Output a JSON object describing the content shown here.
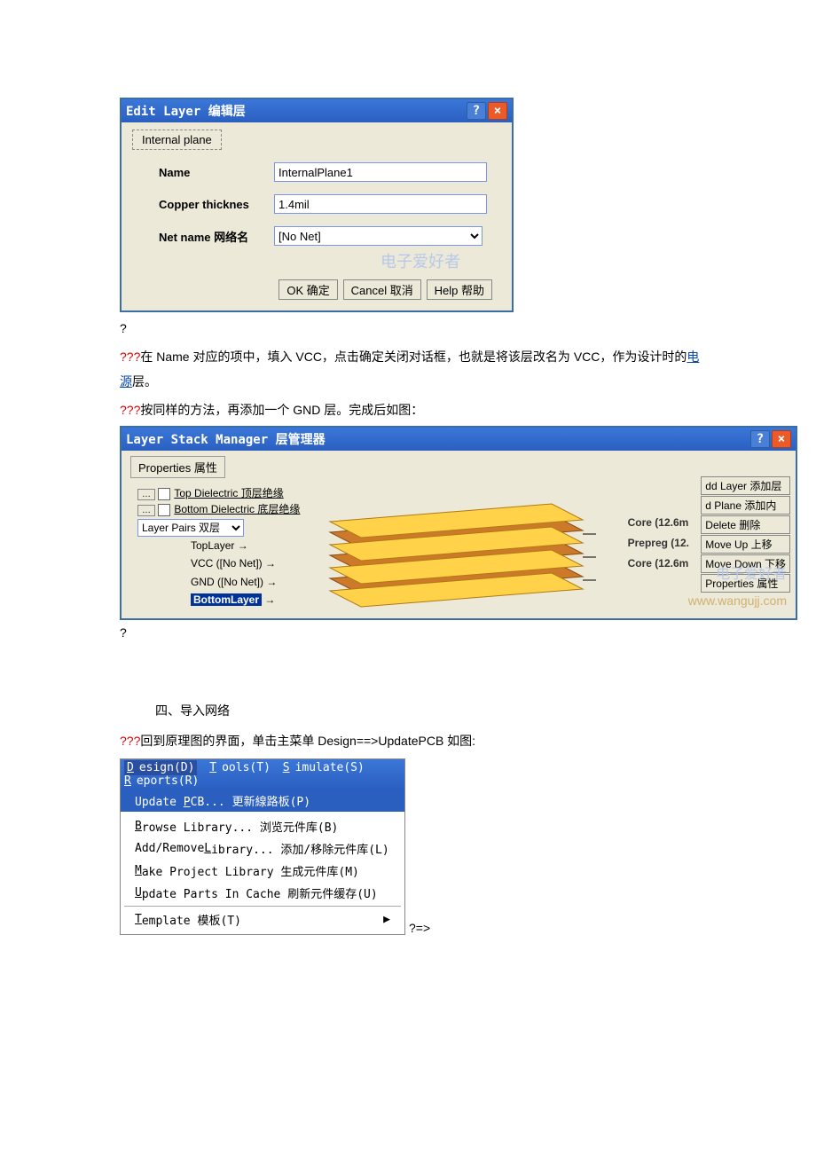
{
  "edit_layer": {
    "title": "Edit Layer 编辑层",
    "tab": "Internal plane",
    "name_label": "Name",
    "name_value": "InternalPlane1",
    "copper_label": "Copper thicknes",
    "copper_value": "1.4mil",
    "net_label": "Net name 网络名",
    "net_value": "[No Net]",
    "watermark": "电子爱好者",
    "ok": "OK 确定",
    "cancel": "Cancel 取消",
    "help": "Help 帮助"
  },
  "after_dialog_q": "?",
  "para1_prefix": "???",
  "para1_a": "在 Name 对应的项中，填入 VCC，点击确定关闭对话框，也就是将该层改名为 VCC，作为设计时的",
  "para1_link": "电源",
  "para1_b": "层。",
  "para2_prefix": "???",
  "para2": "按同样的方法，再添加一个 GND 层。完成后如图：",
  "lsm": {
    "title": "Layer Stack Manager 层管理器",
    "props": "Properties 属性",
    "top_d": "Top Dielectric 顶层绝缘",
    "bot_d": "Bottom Dielectric 底层绝缘",
    "layer_pairs": "Layer Pairs 双层",
    "top_layer": "TopLayer",
    "vcc": "VCC ([No Net])",
    "gnd": "GND ([No Net])",
    "bottom_layer": "BottomLayer",
    "core1": "Core (12.6m",
    "prepreg": "Prepreg (12.",
    "core2": "Core (12.6m",
    "btns": [
      "dd Layer 添加层",
      "d Plane 添加内",
      "Delete 删除",
      "Move Up 上移",
      "Move Down 下移",
      "Properties 属性"
    ],
    "wm1": "电子爱好者",
    "wm2": "www.wangujj.com"
  },
  "after_lsm_q": "?",
  "section4": "四、导入网络",
  "para3_prefix": "???",
  "para3": "回到原理图的界面，单击主菜单 Design==>UpdatePCB 如图:",
  "menu": {
    "bar": {
      "design": "Design(D)",
      "tools": "Tools(T)",
      "simulate": "Simulate(S)",
      "reports": "Reports(R)"
    },
    "update": "Update PCB... 更新線路板(P)",
    "browse": "Browse Library... 浏览元件库(B)",
    "addrem": "Add/Remove Library... 添加/移除元件库(L)",
    "makeproj": "Make Project Library 生成元件库(M)",
    "updcache": "Update Parts In Cache 刷新元件缓存(U)",
    "template": "Template 模板(T)"
  },
  "after_menu": "?=>"
}
